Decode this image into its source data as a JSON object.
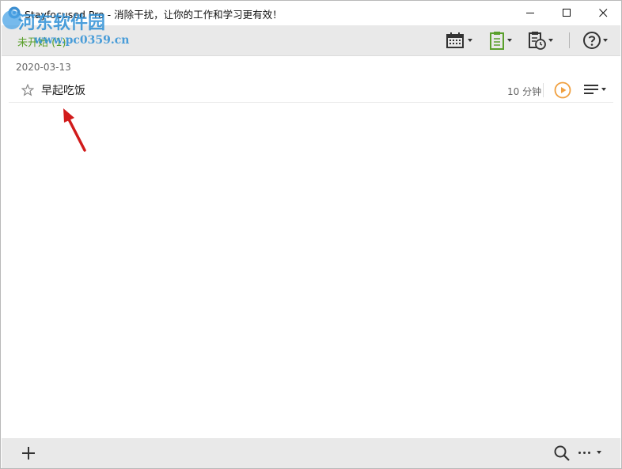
{
  "window": {
    "title": "Stayfocused Pro - 消除干扰，让你的工作和学习更有效！",
    "controls": [
      "minimize",
      "maximize",
      "close"
    ]
  },
  "watermark": {
    "text": "河东软件园",
    "url": "www.pc0359.cn"
  },
  "toolbar": {
    "tab_label": "未开始 (1)",
    "buttons": [
      "calendar-icon",
      "clipboard-icon",
      "schedule-icon",
      "help-icon"
    ],
    "accent": "#5aa02c"
  },
  "list": {
    "date": "2020-03-13",
    "tasks": [
      {
        "title": "早起吃饭",
        "duration": "10 分钟",
        "starred": false
      }
    ]
  },
  "colors": {
    "play_accent": "#f0a040",
    "annotation_arrow": "#d11b1b"
  }
}
